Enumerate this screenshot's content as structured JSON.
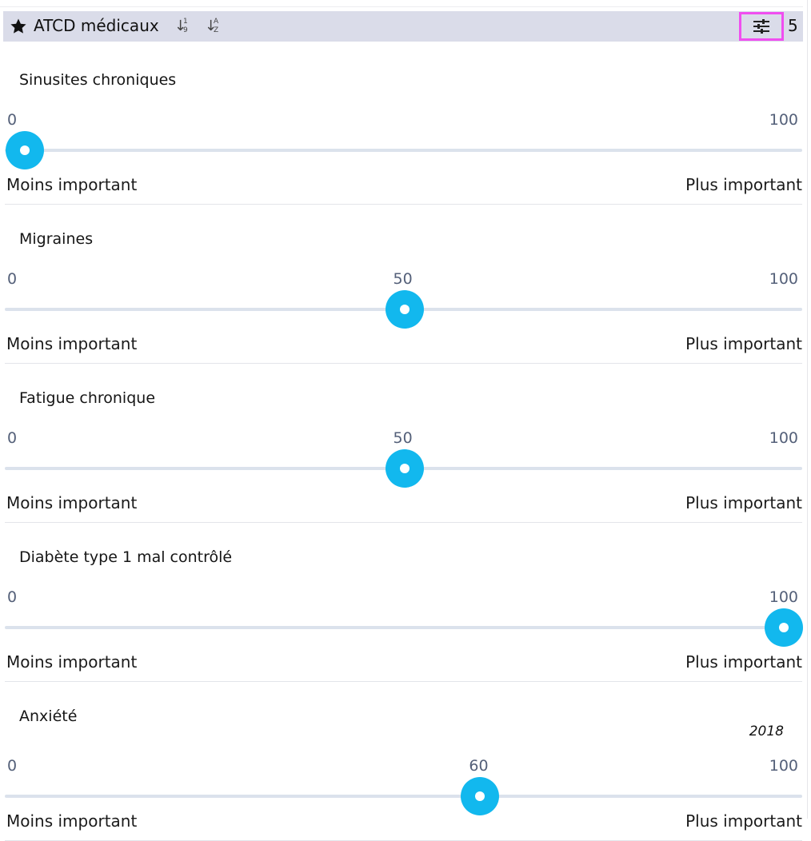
{
  "header": {
    "title": "ATCD médicaux",
    "sort_numeric": {
      "top": "1",
      "bottom": "9"
    },
    "sort_alpha": {
      "top": "A",
      "bottom": "Z"
    },
    "count": "5",
    "icons": {
      "star": "star-icon",
      "filter": "sliders-icon"
    }
  },
  "items": [
    {
      "label": "Sinusites chroniques",
      "value": 0,
      "value_label": "0",
      "min_label": "0",
      "max_label": "100",
      "left_text": "Moins important",
      "right_text": "Plus important"
    },
    {
      "label": "Migraines",
      "value": 50,
      "value_label": "50",
      "min_label": "0",
      "max_label": "100",
      "left_text": "Moins important",
      "right_text": "Plus important"
    },
    {
      "label": "Fatigue chronique",
      "value": 50,
      "value_label": "50",
      "min_label": "0",
      "max_label": "100",
      "left_text": "Moins important",
      "right_text": "Plus important"
    },
    {
      "label": "Diabète type 1 mal contrôlé",
      "value": 100,
      "value_label": "100",
      "min_label": "0",
      "max_label": "100",
      "left_text": "Moins important",
      "right_text": "Plus important"
    },
    {
      "label": "Anxiété",
      "note": "2018",
      "value": 60,
      "value_label": "60",
      "min_label": "0",
      "max_label": "100",
      "left_text": "Moins important",
      "right_text": "Plus important"
    }
  ],
  "colors": {
    "accent": "#12b8ee",
    "header_bg": "#dadce9",
    "focus_outline": "#f04ef0",
    "track": "#dbe2ec",
    "scale_text": "#546079"
  }
}
